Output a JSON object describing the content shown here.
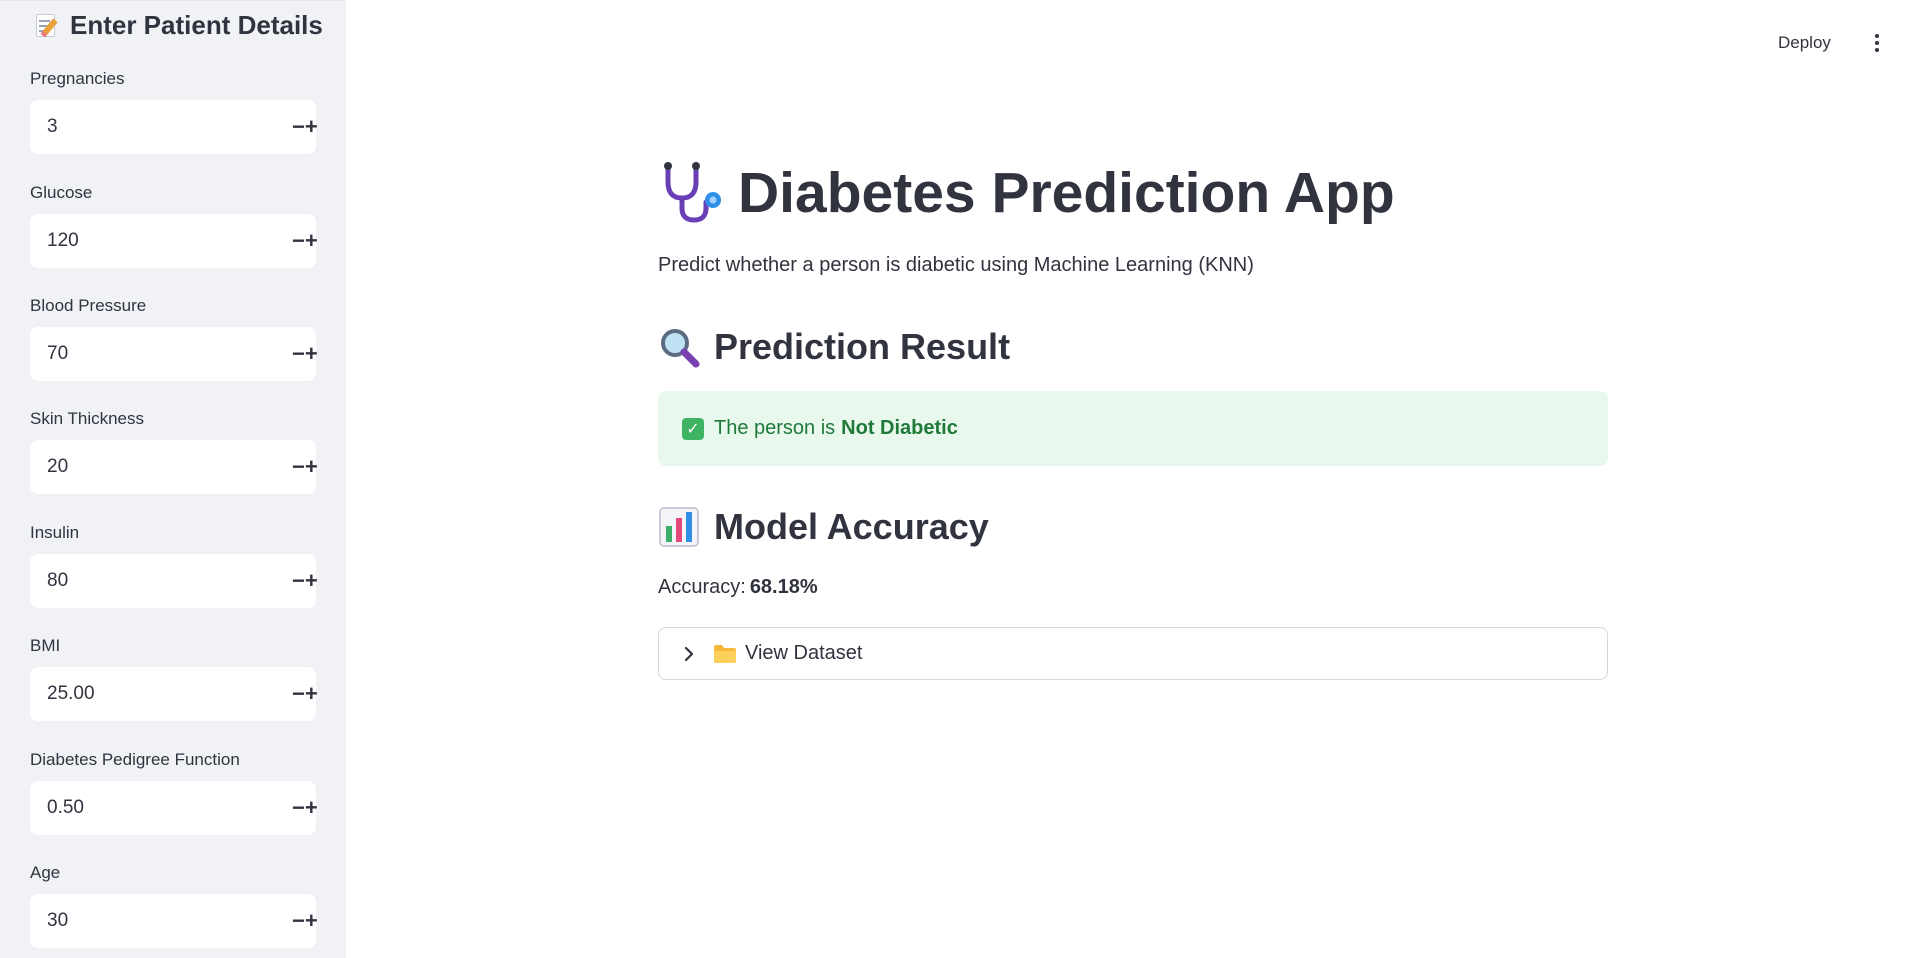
{
  "sidebar": {
    "title": "Enter Patient Details",
    "title_icon": "memo-icon",
    "fields": [
      {
        "label": "Pregnancies",
        "value": "3"
      },
      {
        "label": "Glucose",
        "value": "120"
      },
      {
        "label": "Blood Pressure",
        "value": "70"
      },
      {
        "label": "Skin Thickness",
        "value": "20"
      },
      {
        "label": "Insulin",
        "value": "80"
      },
      {
        "label": "BMI",
        "value": "25.00"
      },
      {
        "label": "Diabetes Pedigree Function",
        "value": "0.50"
      },
      {
        "label": "Age",
        "value": "30"
      }
    ],
    "minus_symbol": "−",
    "plus_symbol": "+"
  },
  "toolbar": {
    "deploy_label": "Deploy",
    "menu_icon": "vertical-dots-icon"
  },
  "main": {
    "title": "Diabetes Prediction App",
    "title_icon": "stethoscope-icon",
    "subtitle": "Predict whether a person is diabetic using Machine Learning (KNN)",
    "prediction": {
      "heading": "Prediction Result",
      "icon": "magnifier-icon",
      "result_prefix": "The person is",
      "result_value": "Not Diabetic",
      "check_symbol": "✓"
    },
    "accuracy": {
      "heading": "Model Accuracy",
      "icon": "bar-chart-icon",
      "label": "Accuracy:",
      "value": "68.18%"
    },
    "expander": {
      "label": "View Dataset",
      "icon": "folder-icon"
    }
  },
  "colors": {
    "sidebar_bg": "#f0f2f6",
    "text": "#31333f",
    "success_bg": "#e8f8ec",
    "success_text": "#1f7a3a"
  }
}
